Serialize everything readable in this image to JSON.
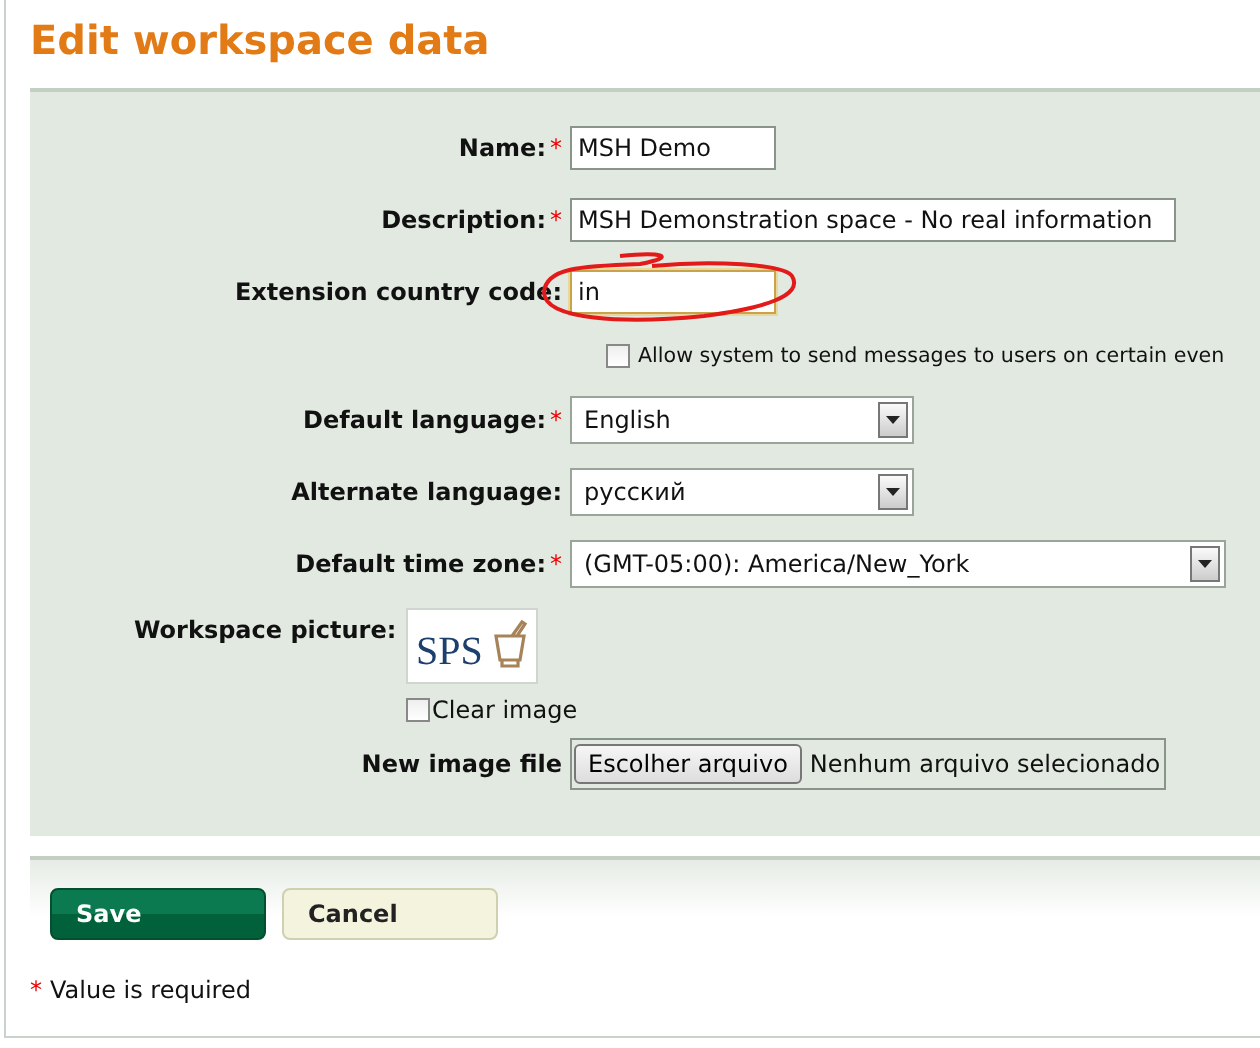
{
  "title": "Edit workspace data",
  "fields": [
    {
      "kind": "text",
      "label": "Name:",
      "required": true,
      "value": "MSH Demo",
      "focused": false
    },
    {
      "kind": "text",
      "label": "Description:",
      "required": true,
      "value": "MSH Demonstration space - No real information",
      "focused": false
    },
    {
      "kind": "text",
      "label": "Extension country code:",
      "required": false,
      "value": "in",
      "focused": true
    },
    {
      "kind": "checkbox",
      "label": "Allow system to send messages to users on certain even",
      "checked": false
    },
    {
      "kind": "select",
      "label": "Default language:",
      "required": true,
      "value": "English"
    },
    {
      "kind": "select",
      "label": "Alternate language:",
      "required": false,
      "value": "русский"
    },
    {
      "kind": "select",
      "label": "Default time zone:",
      "required": true,
      "value": "(GMT-05:00): America/New_York"
    },
    {
      "kind": "image",
      "label": "Workspace picture:",
      "logo_text": "SPS",
      "clear_label": "Clear image",
      "clear_checked": false
    },
    {
      "kind": "file",
      "label": "New image file",
      "button": "Escolher arquivo",
      "status": "Nenhum arquivo selecionado"
    }
  ],
  "buttons": [
    {
      "label": "Save",
      "kind": "primary"
    },
    {
      "label": "Cancel",
      "kind": "secondary"
    }
  ],
  "footnote": {
    "mark": "*",
    "text": "Value is required"
  }
}
